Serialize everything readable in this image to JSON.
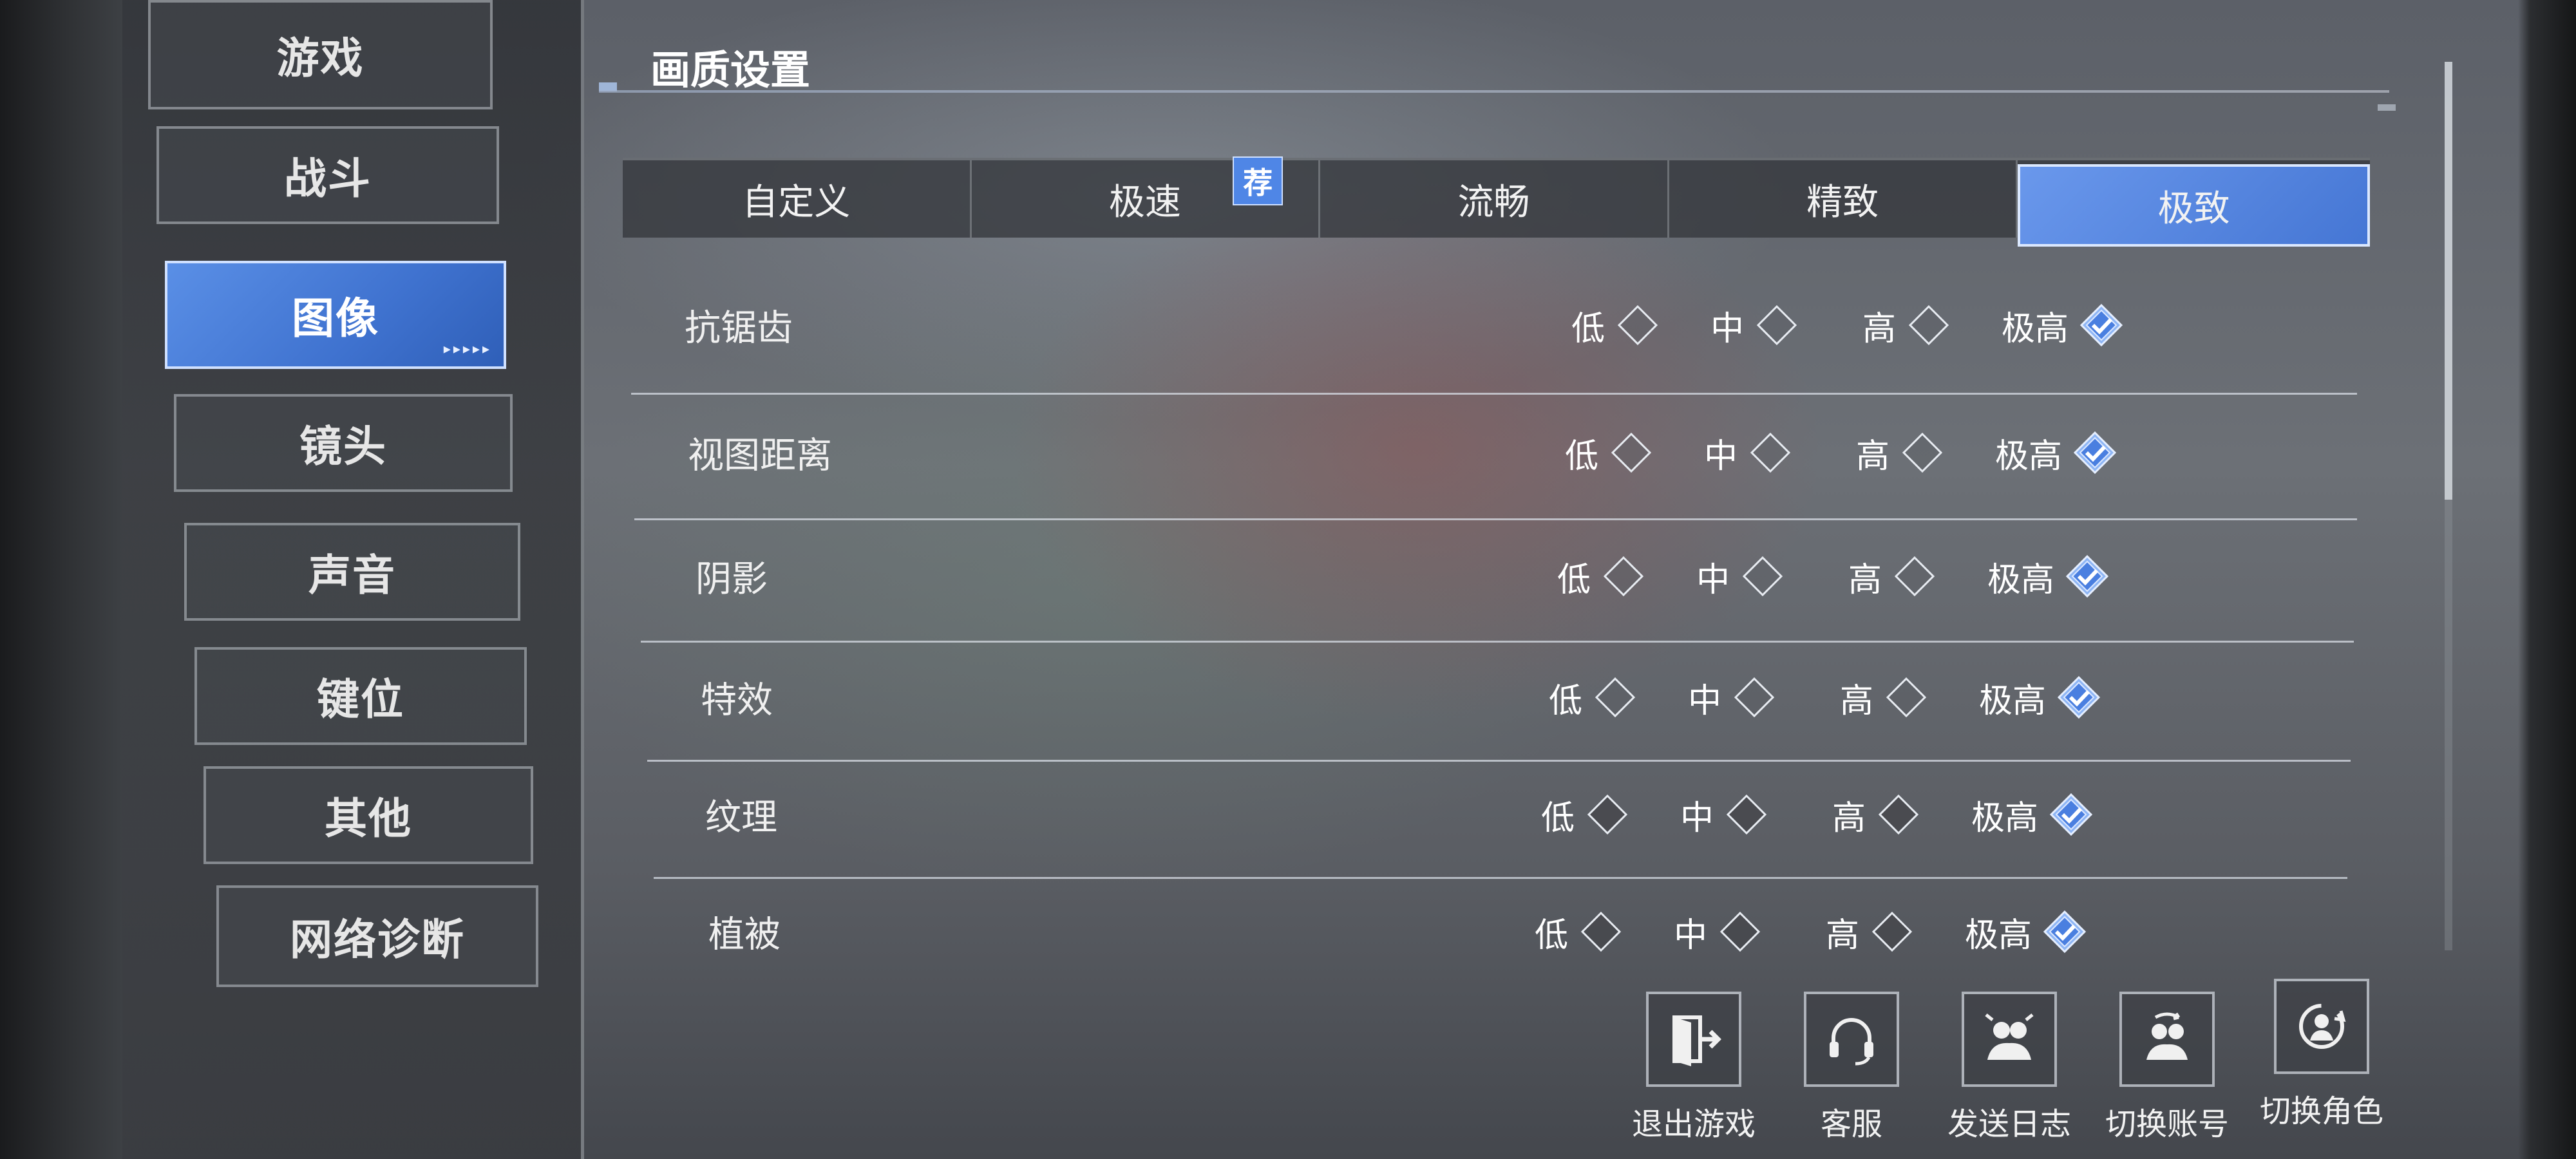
{
  "sidebar": {
    "items": [
      {
        "label": "游戏",
        "active": false
      },
      {
        "label": "战斗",
        "active": false
      },
      {
        "label": "图像",
        "active": true
      },
      {
        "label": "镜头",
        "active": false
      },
      {
        "label": "声音",
        "active": false
      },
      {
        "label": "键位",
        "active": false
      },
      {
        "label": "其他",
        "active": false
      },
      {
        "label": "网络诊断",
        "active": false
      }
    ],
    "active_indicator": "▸▸▸▸▸"
  },
  "main": {
    "section_title": "画质设置",
    "presets": [
      {
        "label": "自定义",
        "active": false
      },
      {
        "label": "极速",
        "active": false,
        "badge": "荐"
      },
      {
        "label": "流畅",
        "active": false
      },
      {
        "label": "精致",
        "active": false
      },
      {
        "label": "极致",
        "active": true
      }
    ],
    "settings": [
      {
        "label": "抗锯齿",
        "options": [
          "低",
          "中",
          "高",
          "极高"
        ],
        "selected": "极高"
      },
      {
        "label": "视图距离",
        "options": [
          "低",
          "中",
          "高",
          "极高"
        ],
        "selected": "极高"
      },
      {
        "label": "阴影",
        "options": [
          "低",
          "中",
          "高",
          "极高"
        ],
        "selected": "极高"
      },
      {
        "label": "特效",
        "options": [
          "低",
          "中",
          "高",
          "极高"
        ],
        "selected": "极高"
      },
      {
        "label": "纹理",
        "options": [
          "低",
          "中",
          "高",
          "极高"
        ],
        "selected": "极高"
      },
      {
        "label": "植被",
        "options": [
          "低",
          "中",
          "高",
          "极高"
        ],
        "selected": "极高"
      }
    ]
  },
  "actions": [
    {
      "label": "退出游戏",
      "icon": "exit-door-icon"
    },
    {
      "label": "客服",
      "icon": "headset-icon"
    },
    {
      "label": "发送日志",
      "icon": "send-log-icon"
    },
    {
      "label": "切换账号",
      "icon": "switch-account-icon"
    },
    {
      "label": "切换角色",
      "icon": "switch-character-icon"
    }
  ],
  "colors": {
    "accent": "#4a7fe0",
    "selected_check": "#6fa0f0"
  }
}
